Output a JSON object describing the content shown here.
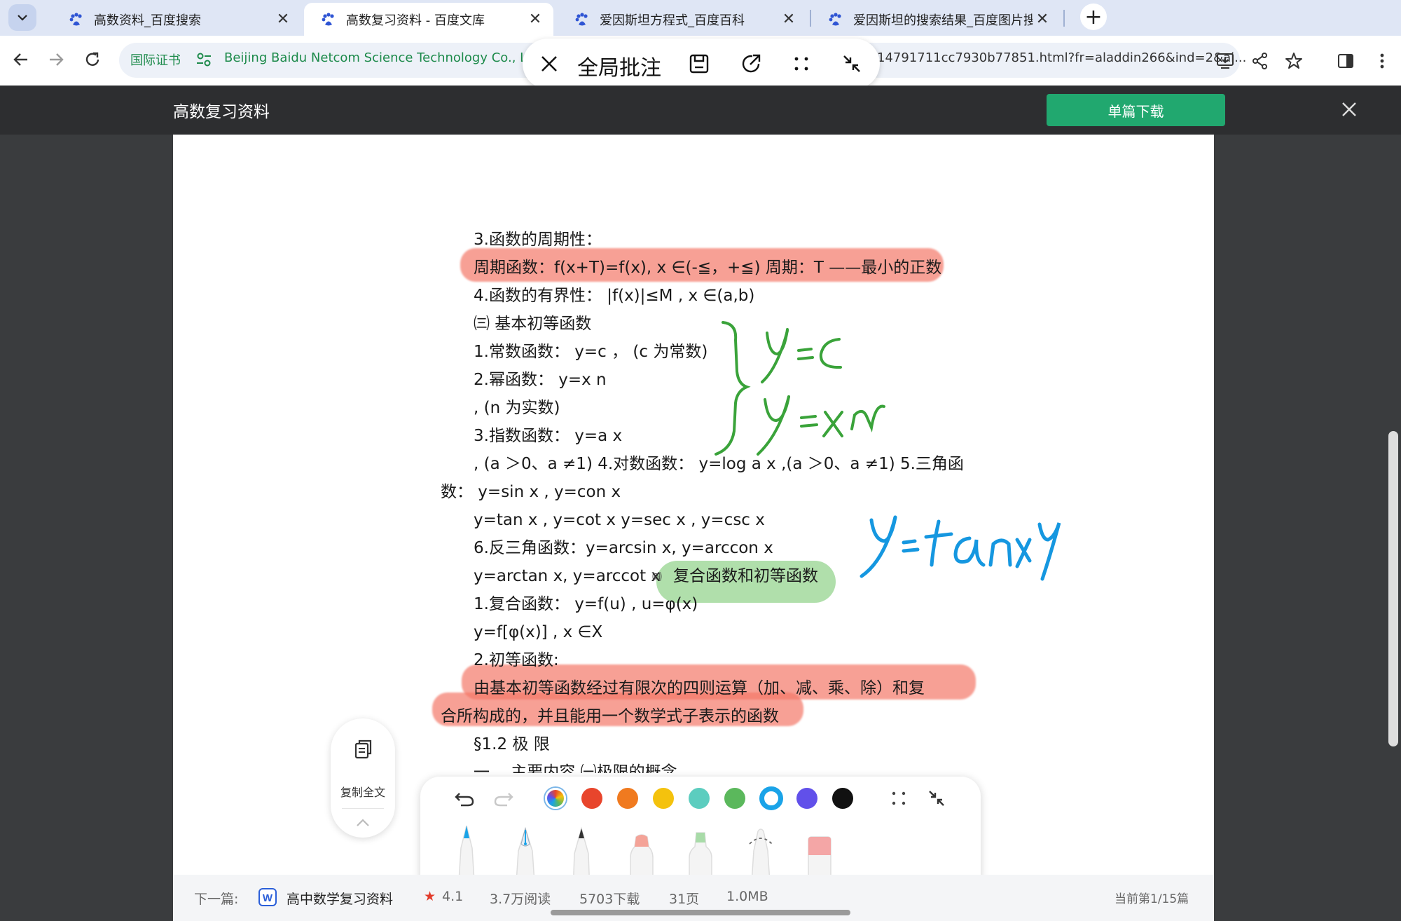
{
  "browser": {
    "tabs": [
      {
        "title": "高数资料_百度搜索",
        "active": false
      },
      {
        "title": "高数复习资料 - 百度文库",
        "active": true
      },
      {
        "title": "爱因斯坦方程式_百度百科",
        "active": false
      },
      {
        "title": "爱因斯坦的搜索结果_百度图片搜",
        "active": false
      }
    ],
    "cert_label": "国际证书",
    "site_org": "Beijing Baidu Netcom Science Technology Co., Ltd[",
    "url_tail": "14791711cc7930b77851.html?fr=aladdin266&ind=2&ai..."
  },
  "annotation_bar": {
    "title": "全局批注"
  },
  "doc_header": {
    "title": "高数复习资料",
    "download_label": "单篇下载"
  },
  "document": {
    "lines": [
      "3.函数的周期性：",
      "周期函数：f(x+T)=f(x), x ∈(-≦，+≦) 周期：T ——最小的正数",
      "4.函数的有界性： |f(x)|≤M , x ∈(a,b)",
      "㈢ 基本初等函数",
      "1.常数函数： y=c ， (c 为常数)",
      "2.幂函数： y=x n",
      ", (n 为实数)",
      "3.指数函数： y=a x",
      ", (a ＞0、a ≠1) 4.对数函数： y=log a x ,(a ＞0、a ≠1) 5.三角函",
      "数： y=sin x , y=con x",
      "y=tan x , y=cot x y=sec x , y=csc x",
      "6.反三角函数：y=arcsin x, y=arccon x",
      "y=arctan x, y=arccot x",
      "㈣",
      "复合函数和初等函数",
      "1.复合函数： y=f(u) , u=φ(x)",
      "y=f[φ(x)] , x ∈X",
      "2.初等函数:",
      "由基本初等函数经过有限次的四则运算（加、减、乘、除）和复",
      "合所构成的，并且能用一个数学式子表示的函数",
      "§1.2 极 限",
      "一、 主要内容 ㈠极限的概念"
    ]
  },
  "copy_button": {
    "label": "复制全文"
  },
  "pen_toolbar": {
    "colors": [
      "#e8452c",
      "#f07a1f",
      "#f4c20d",
      "#5ccdbf",
      "#5bb85c",
      "#1aa3e8",
      "#6150ea",
      "#111111"
    ],
    "selected_color": "#1aa3e8"
  },
  "bottom_bar": {
    "next_label": "下一篇:",
    "next_title": "高中数学复习资料",
    "rating": "4.1",
    "reads": "3.7万阅读",
    "downloads": "5703下载",
    "pages": "31页",
    "size": "1.0MB",
    "position": "当前第1/15篇"
  }
}
